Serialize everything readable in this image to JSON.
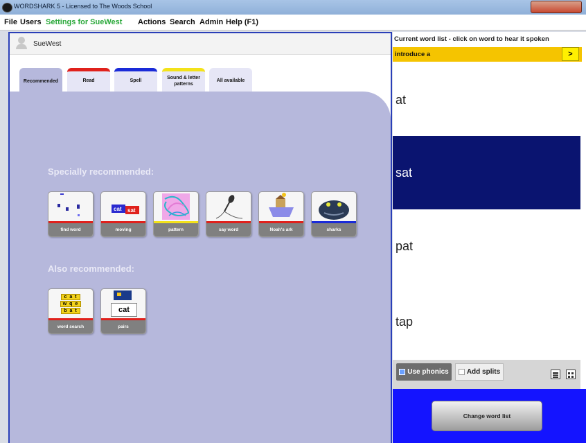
{
  "window": {
    "title": "WORDSHARK 5  -  Licensed to The Woods School"
  },
  "menu": {
    "file": "File",
    "users": "Users",
    "settings": "Settings for SueWest",
    "actions": "Actions",
    "search": "Search",
    "admin": "Admin",
    "help": "Help (F1)"
  },
  "user": {
    "name": "SueWest"
  },
  "tabs": [
    {
      "label": "Recommended",
      "color": ""
    },
    {
      "label": "Read",
      "color": "#e0211c"
    },
    {
      "label": "Spell",
      "color": "#1a2bd8"
    },
    {
      "label": "Sound & letter patterns",
      "color": "#f3e21a"
    },
    {
      "label": "All available",
      "color": ""
    }
  ],
  "sections": {
    "special": "Specially recommended:",
    "also": "Also recommended:"
  },
  "games_special": [
    {
      "label": "find word",
      "bar_color": "#e0211c",
      "icon": "find-word-icon"
    },
    {
      "label": "moving",
      "bar_color": "#e0211c",
      "icon": "moving-icon",
      "words": [
        "cat",
        "sat"
      ]
    },
    {
      "label": "pattern",
      "bar_color": "#f3e21a",
      "icon": "pattern-icon"
    },
    {
      "label": "say word",
      "bar_color": "#e0211c",
      "icon": "microphone-icon"
    },
    {
      "label": "Noah's ark",
      "bar_color": "#e0211c",
      "icon": "ark-icon"
    },
    {
      "label": "sharks",
      "bar_color": "#1a2bd8",
      "icon": "shark-icon"
    }
  ],
  "games_also": [
    {
      "label": "word search",
      "bar_color": "#e0211c",
      "icon": "word-search-icon",
      "grid": [
        "c a t",
        "w q e",
        "b a t"
      ]
    },
    {
      "label": "pairs",
      "bar_color": "#e0211c",
      "icon": "pairs-icon",
      "word": "cat"
    }
  ],
  "wordlist": {
    "header": "Current word list - click on word to hear it spoken",
    "name": "introduce a",
    "next": ">",
    "words": [
      "at",
      "sat",
      "pat",
      "tap"
    ],
    "selected_index": 1
  },
  "options": {
    "use_phonics": "Use phonics",
    "add_splits": "Add splits"
  },
  "change_list": "Change word list",
  "colors": {
    "accent_blue": "#1414ff",
    "selected_word": "#0a1470",
    "list_bar": "#f5c400"
  }
}
